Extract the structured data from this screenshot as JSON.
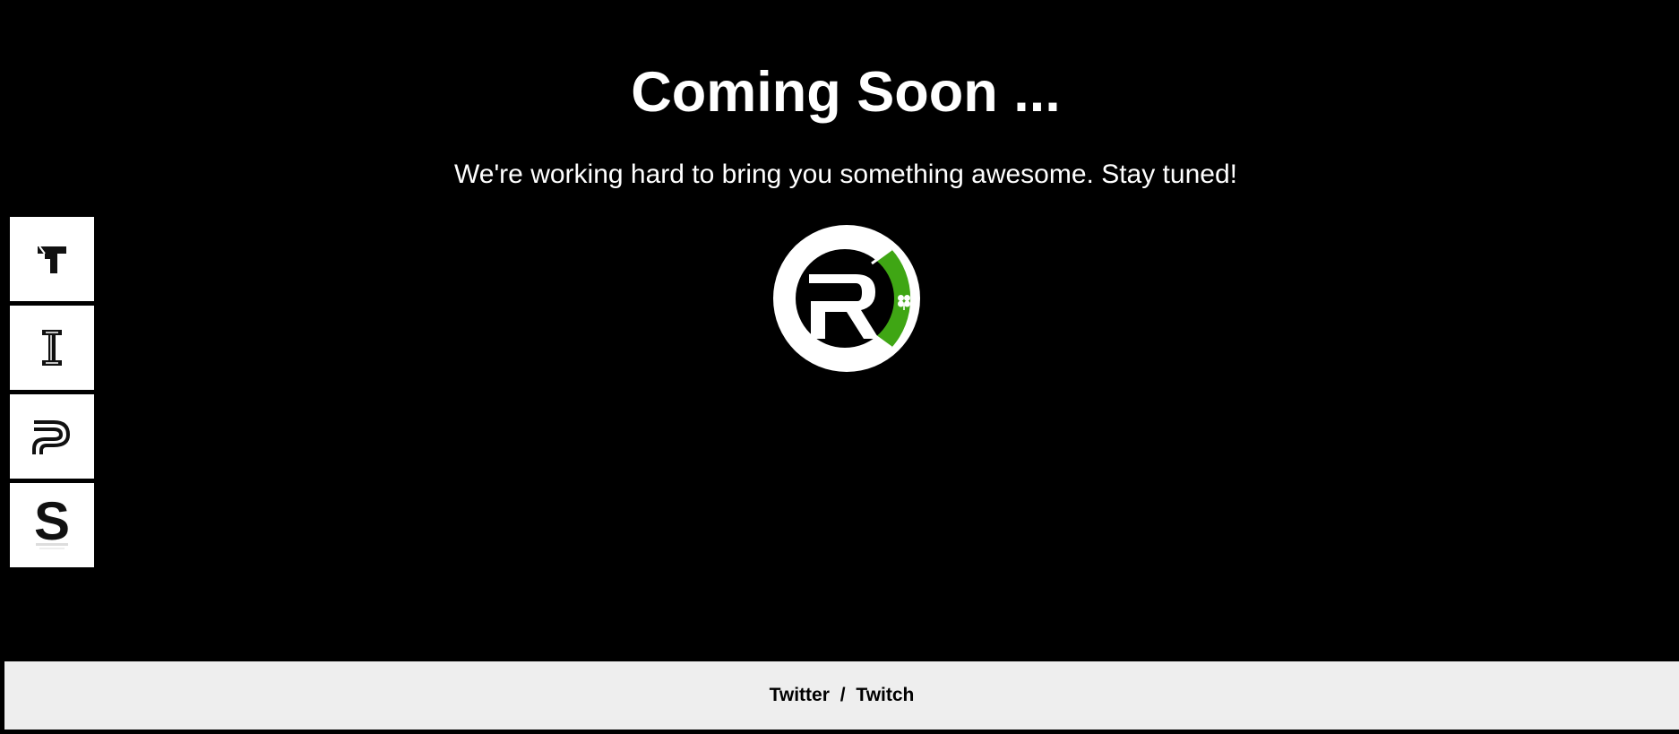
{
  "header": {
    "title": "Coming Soon ...",
    "subtitle": "We're working hard to bring you something awesome. Stay tuned!"
  },
  "logo": {
    "letter": "R",
    "accent_color": "#3fa614",
    "icon": "clover-icon"
  },
  "sidebar": {
    "items": [
      {
        "icon": "t-logo-icon"
      },
      {
        "icon": "i-logo-icon"
      },
      {
        "icon": "p-logo-icon"
      },
      {
        "icon": "s-logo-icon"
      }
    ]
  },
  "footer": {
    "link_twitter": "Twitter",
    "separator": "/",
    "link_twitch": "Twitch",
    "background": "#eeeeee"
  }
}
